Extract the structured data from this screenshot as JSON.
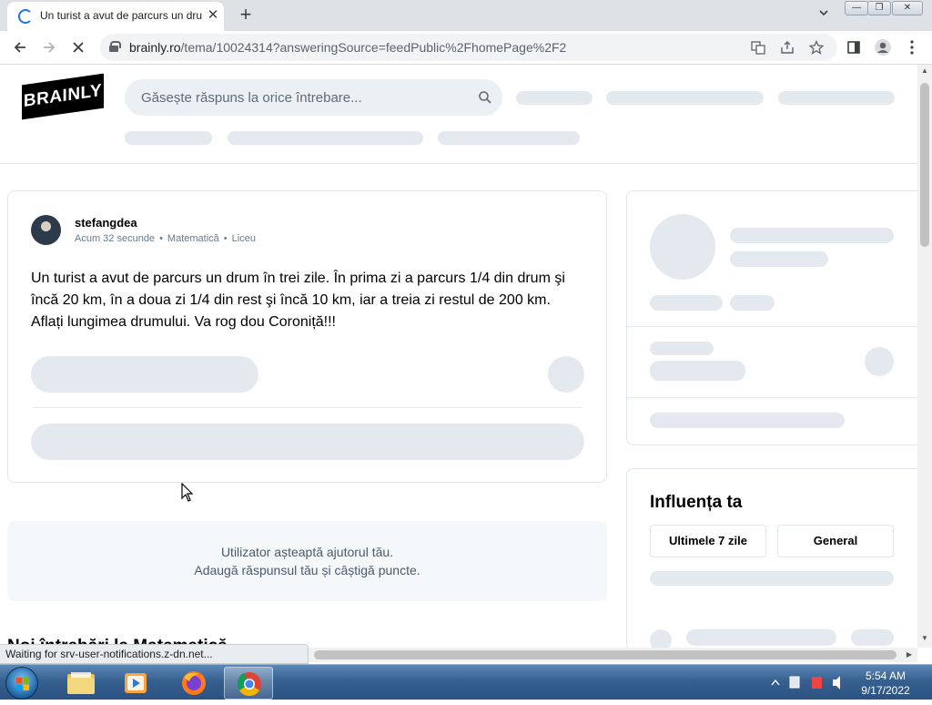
{
  "browser": {
    "tab_title": "Un turist a avut de parcurs un drum în trei zile. În prima zi a parcurs",
    "tab_close": "✕",
    "new_tab": "+",
    "url_host": "brainly.ro",
    "url_rest": "/tema/10024314?answeringSource=feedPublic%2FhomePage%2F2",
    "status_text": "Waiting for srv-user-notifications.z-dn.net...",
    "window_buttons": [
      "—",
      "❐",
      "✕"
    ]
  },
  "site": {
    "logo_text": "BRAINLY",
    "search_placeholder": "Găsește răspuns la orice întrebare..."
  },
  "question": {
    "author": "stefangdea",
    "time": "Acum 32 secunde",
    "subject": "Matematică",
    "level": "Liceu",
    "text": "Un turist a avut de parcurs un drum în trei zile. În prima zi a parcurs 1/4 din drum şi încă 20 km, în a doua zi 1/4 din rest şi încă 10 km, iar a treia zi restul de 200 km. Aflați lungimea drumului. Va rog dou Coroniță!!!"
  },
  "waiting": {
    "line1": "Utilizator așteaptă ajutorul tău.",
    "line2": "Adaugă răspunsul tău și câștigă puncte."
  },
  "related_title": "Noi întrebări la Matematică",
  "influence": {
    "title": "Influența ta",
    "tabs": [
      "Ultimele 7 zile",
      "General"
    ]
  },
  "taskbar": {
    "time": "5:54 AM",
    "date": "9/17/2022"
  },
  "colors": {
    "chrome_tabstrip": "#dee1e6",
    "skeleton": "#e4e9ef",
    "search_bg": "#ebf0f4",
    "taskbar": "#36608f"
  }
}
